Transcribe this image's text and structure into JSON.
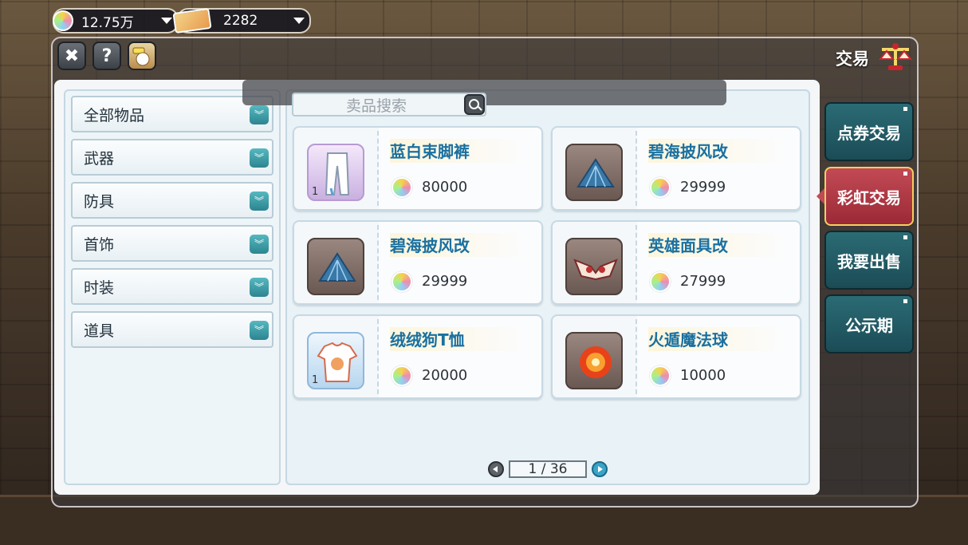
{
  "currency": {
    "rainbow_amount": "12.75万",
    "ticket_amount": "2282"
  },
  "window": {
    "title": "交易",
    "icon_names": [
      "close-icon",
      "help-icon",
      "vip-icon",
      "scale-icon"
    ]
  },
  "categories": [
    {
      "label": "全部物品"
    },
    {
      "label": "武器"
    },
    {
      "label": "防具"
    },
    {
      "label": "首饰"
    },
    {
      "label": "时装"
    },
    {
      "label": "道具"
    }
  ],
  "search": {
    "placeholder": "卖品搜索"
  },
  "items": [
    {
      "name": "蓝白束脚裤",
      "price": "80000",
      "qty": "1",
      "icon": "pants-icon"
    },
    {
      "name": "碧海披风改",
      "price": "29999",
      "qty": "",
      "icon": "cape-icon"
    },
    {
      "name": "碧海披风改",
      "price": "29999",
      "qty": "",
      "icon": "cape-icon"
    },
    {
      "name": "英雄面具改",
      "price": "27999",
      "qty": "",
      "icon": "mask-icon"
    },
    {
      "name": "绒绒狗T恤",
      "price": "20000",
      "qty": "1",
      "icon": "tshirt-icon"
    },
    {
      "name": "火遁魔法球",
      "price": "10000",
      "qty": "",
      "icon": "fire-orb-icon"
    }
  ],
  "pagination": {
    "label": "1 / 36",
    "current": 1,
    "total": 36
  },
  "tabs": [
    {
      "label": "点券交易",
      "active": false
    },
    {
      "label": "彩虹交易",
      "active": true
    },
    {
      "label": "我要出售",
      "active": false
    },
    {
      "label": "公示期",
      "active": false
    }
  ],
  "colors": {
    "tab_normal": "#2b6b74",
    "tab_active": "#c24a55",
    "item_name": "#1a70a0"
  }
}
